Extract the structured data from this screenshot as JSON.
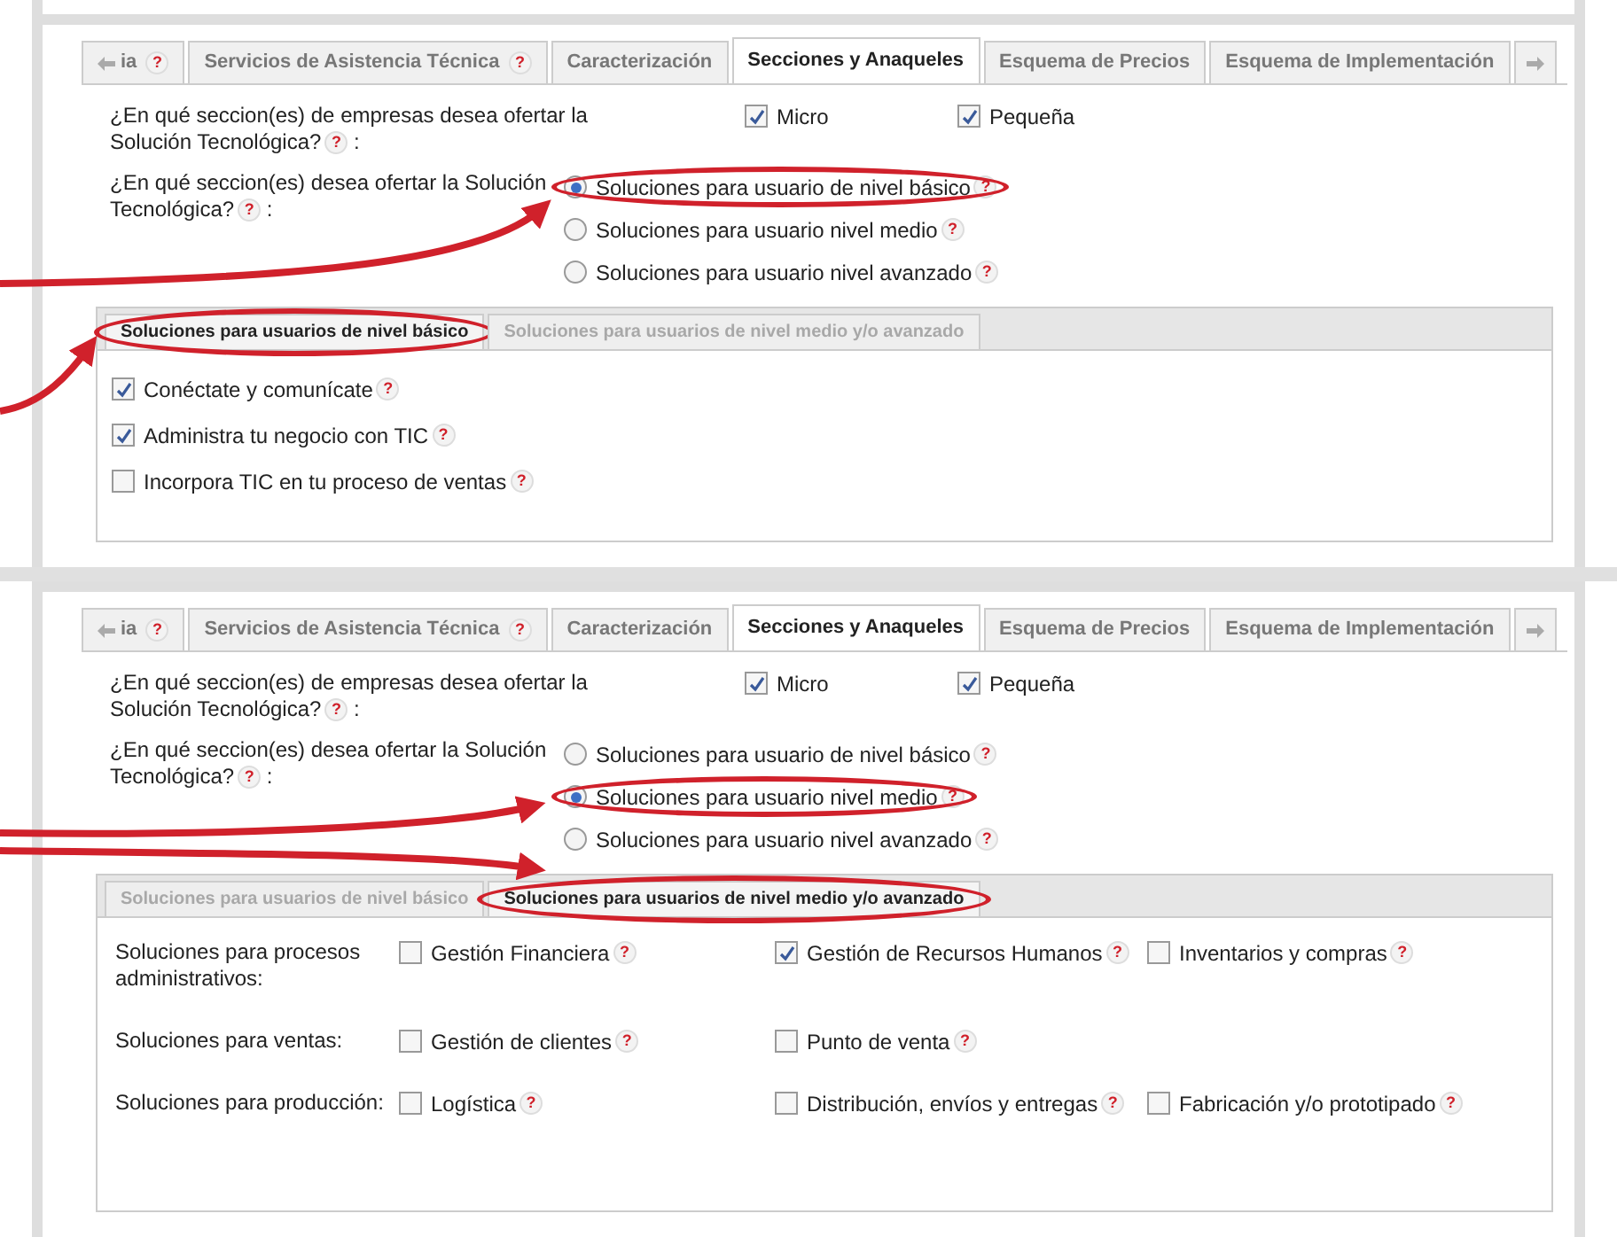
{
  "panels": [
    {
      "tabs": [
        {
          "label": "ia",
          "help": "?",
          "selected": false,
          "kind": "back"
        },
        {
          "label": "Servicios de Asistencia Técnica",
          "help": "?",
          "selected": false
        },
        {
          "label": "Caracterización",
          "selected": false
        },
        {
          "label": "Secciones y Anaqueles",
          "selected": true
        },
        {
          "label": "Esquema de Precios",
          "selected": false
        },
        {
          "label": "Esquema de Implementación",
          "selected": false
        }
      ],
      "sizes": {
        "label": "¿En qué seccion(es) de empresas desea ofertar la Solución Tecnológica?",
        "help": "?",
        "suffix": ":",
        "options": [
          {
            "label": "Micro",
            "checked": true
          },
          {
            "label": "Pequeña",
            "checked": true
          }
        ]
      },
      "levels": {
        "label": "¿En qué seccion(es) desea ofertar la Solución Tecnológica?",
        "help": "?",
        "suffix": ":",
        "options": [
          {
            "label": "Soluciones para usuario de nivel básico",
            "help": "?",
            "selected": true,
            "circled": true
          },
          {
            "label": "Soluciones para usuario nivel medio",
            "help": "?",
            "selected": false,
            "circled": false
          },
          {
            "label": "Soluciones para usuario nivel avanzado",
            "help": "?",
            "selected": false,
            "circled": false
          }
        ]
      },
      "subtabs": [
        {
          "label": "Soluciones para usuarios de nivel básico",
          "selected": true,
          "circled": true
        },
        {
          "label": "Soluciones para usuarios de nivel medio y/o avanzado",
          "selected": false,
          "circled": false
        }
      ],
      "content": {
        "kind": "list",
        "items": [
          {
            "label": "Conéctate y comunícate",
            "help": "?",
            "checked": true
          },
          {
            "label": "Administra tu negocio con TIC",
            "help": "?",
            "checked": true
          },
          {
            "label": "Incorpora TIC en tu proceso de ventas",
            "help": "?",
            "checked": false
          }
        ]
      }
    },
    {
      "tabs": [
        {
          "label": "ia",
          "help": "?",
          "selected": false,
          "kind": "back"
        },
        {
          "label": "Servicios de Asistencia Técnica",
          "help": "?",
          "selected": false
        },
        {
          "label": "Caracterización",
          "selected": false
        },
        {
          "label": "Secciones y Anaqueles",
          "selected": true
        },
        {
          "label": "Esquema de Precios",
          "selected": false
        },
        {
          "label": "Esquema de Implementación",
          "selected": false
        }
      ],
      "sizes": {
        "label": "¿En qué seccion(es) de empresas desea ofertar la Solución Tecnológica?",
        "help": "?",
        "suffix": ":",
        "options": [
          {
            "label": "Micro",
            "checked": true
          },
          {
            "label": "Pequeña",
            "checked": true
          }
        ]
      },
      "levels": {
        "label": "¿En qué seccion(es) desea ofertar la Solución Tecnológica?",
        "help": "?",
        "suffix": ":",
        "options": [
          {
            "label": "Soluciones para usuario de nivel básico",
            "help": "?",
            "selected": false,
            "circled": false
          },
          {
            "label": "Soluciones para usuario nivel medio",
            "help": "?",
            "selected": true,
            "circled": true
          },
          {
            "label": "Soluciones para usuario nivel avanzado",
            "help": "?",
            "selected": false,
            "circled": false
          }
        ]
      },
      "subtabs": [
        {
          "label": "Soluciones para usuarios de nivel básico",
          "selected": false,
          "circled": false
        },
        {
          "label": "Soluciones para usuarios de nivel medio y/o avanzado",
          "selected": true,
          "circled": true
        }
      ],
      "content": {
        "kind": "grid",
        "rows": [
          {
            "label": "Soluciones para procesos administrativos:",
            "options": [
              {
                "label": "Gestión Financiera",
                "help": "?",
                "checked": false
              },
              {
                "label": "Gestión de Recursos Humanos",
                "help": "?",
                "checked": true
              },
              {
                "label": "Inventarios y compras",
                "help": "?",
                "checked": false
              }
            ]
          },
          {
            "label": "Soluciones para ventas:",
            "options": [
              {
                "label": "Gestión de clientes",
                "help": "?",
                "checked": false
              },
              {
                "label": "Punto de venta",
                "help": "?",
                "checked": false
              }
            ]
          },
          {
            "label": "Soluciones para producción:",
            "options": [
              {
                "label": "Logística",
                "help": "?",
                "checked": false
              },
              {
                "label": "Distribución, envíos y entregas",
                "help": "?",
                "checked": false
              },
              {
                "label": "Fabricación y/o prototipado",
                "help": "?",
                "checked": false
              }
            ]
          }
        ]
      }
    }
  ]
}
